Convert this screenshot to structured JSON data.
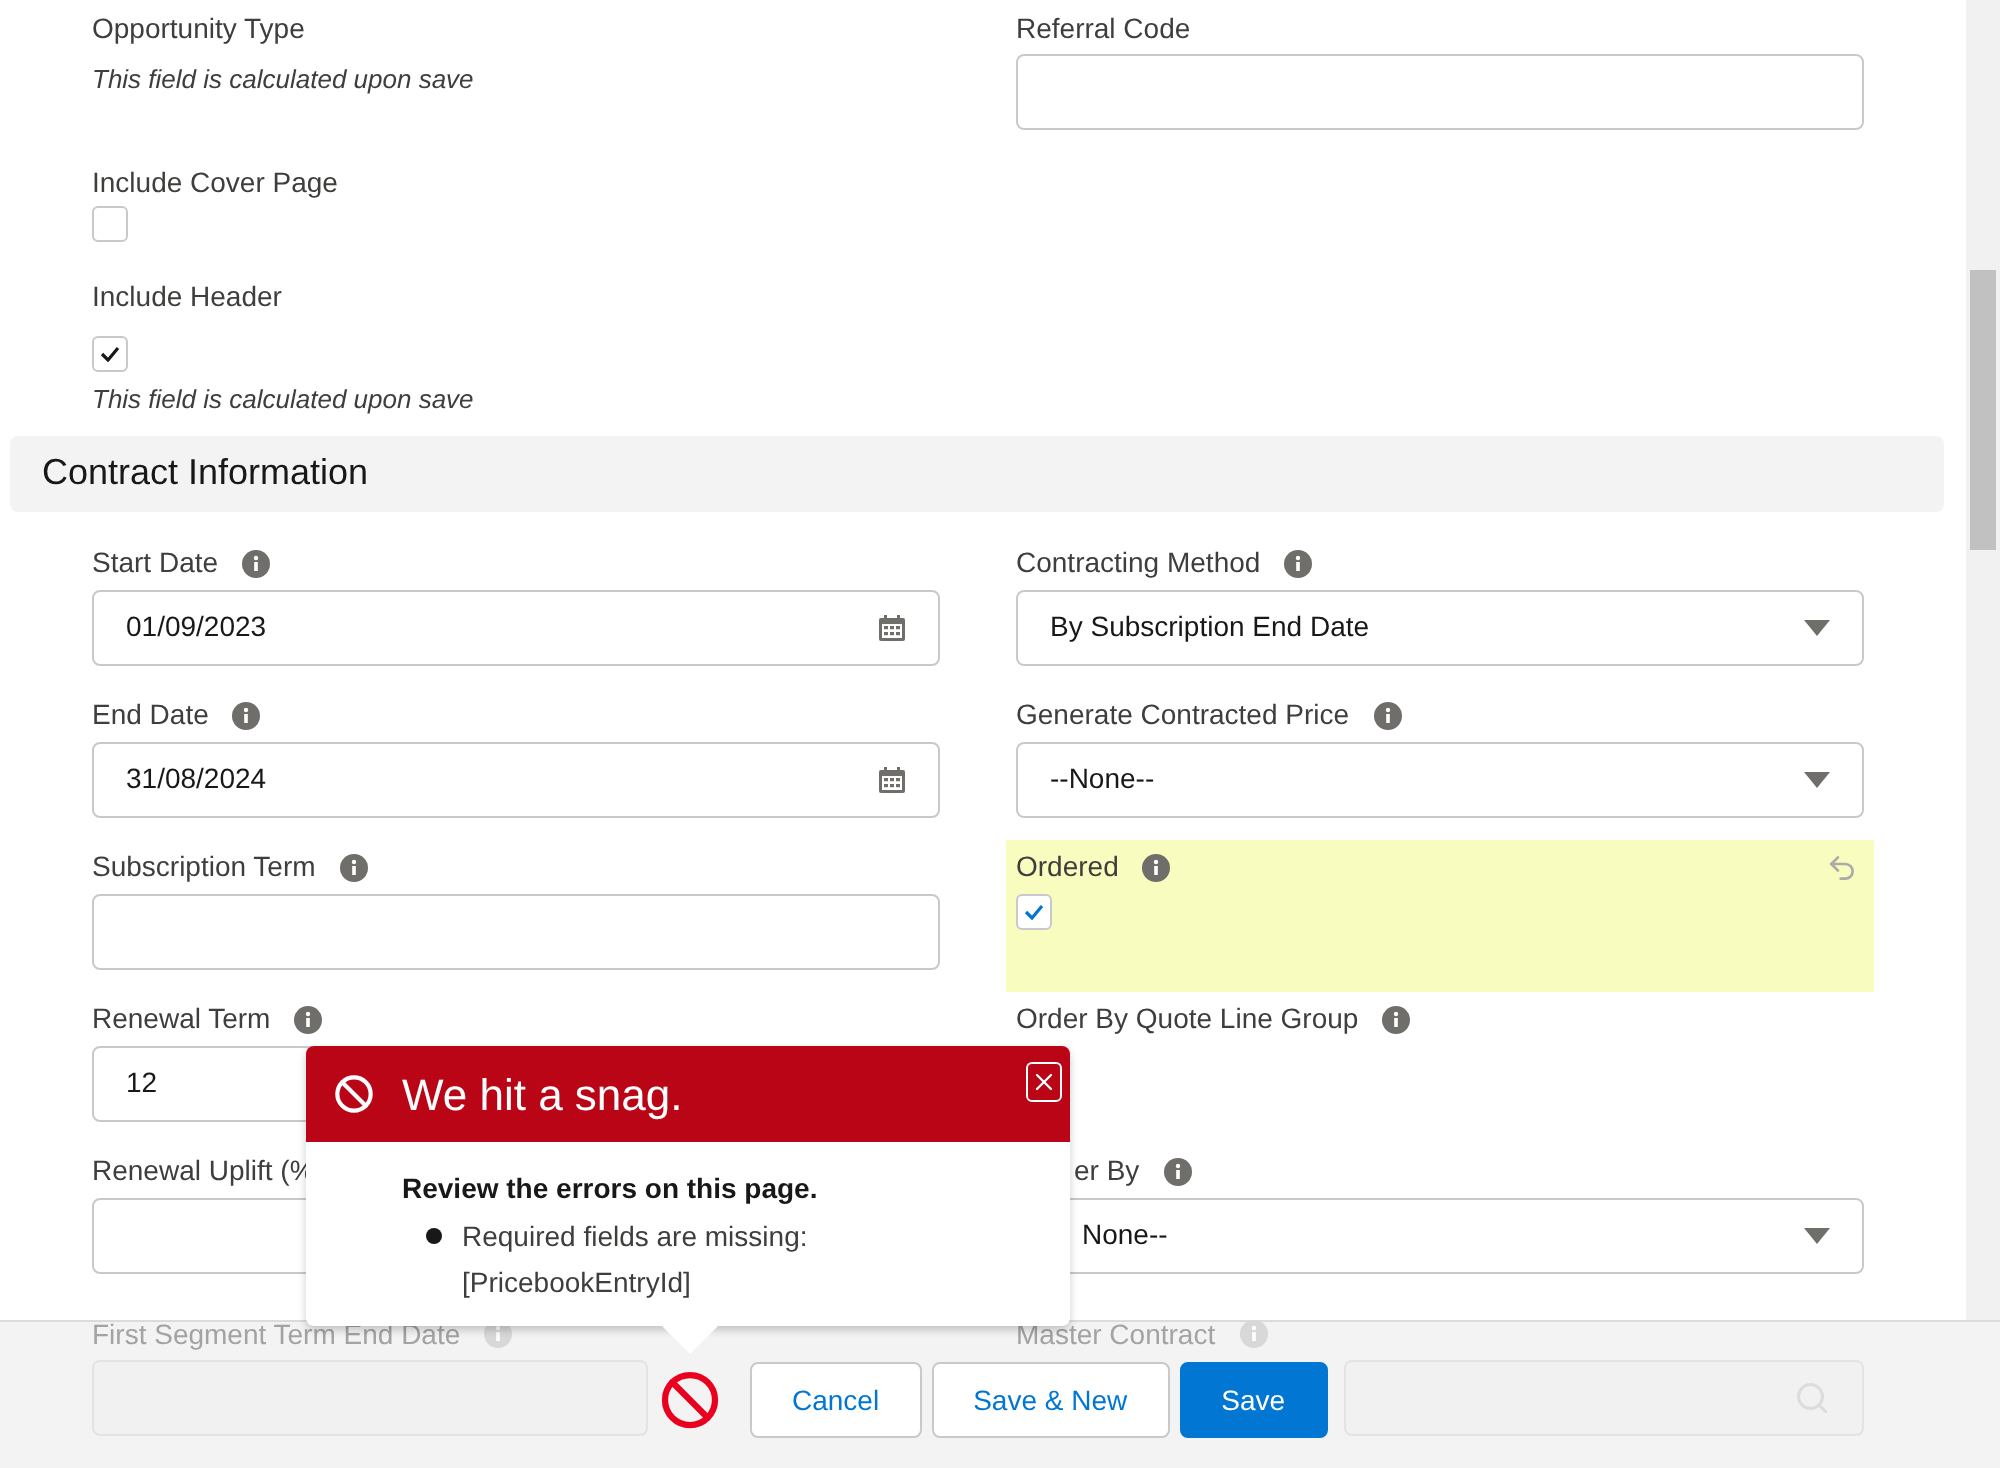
{
  "top_section": {
    "left": [
      {
        "kind": "calculated",
        "label": "Opportunity Type",
        "note": "This field is calculated upon save"
      },
      {
        "kind": "checkbox",
        "label": "Include Cover Page",
        "checked": false
      },
      {
        "kind": "checkbox",
        "label": "Include Header",
        "checked": true,
        "note": "This field is calculated upon save"
      }
    ],
    "right": [
      {
        "kind": "text",
        "label": "Referral Code"
      }
    ]
  },
  "section": {
    "title": "Contract Information",
    "rows": [
      [
        {
          "kind": "date",
          "label": "Start Date",
          "info": true,
          "value": "01/09/2023"
        },
        {
          "kind": "select",
          "label": "Contracting Method",
          "info": true,
          "value": "By Subscription End Date"
        }
      ],
      [
        {
          "kind": "date",
          "label": "End Date",
          "info": true,
          "value": "31/08/2024"
        },
        {
          "kind": "select",
          "label": "Generate Contracted Price",
          "info": true,
          "value": "--None--"
        }
      ],
      [
        {
          "kind": "text",
          "label": "Subscription Term",
          "info": true
        },
        {
          "kind": "checkbox",
          "label": "Ordered",
          "info": true,
          "checked": true,
          "changed": true
        }
      ],
      [
        {
          "kind": "text",
          "label": "Renewal Term",
          "info": true,
          "value": "12"
        },
        {
          "kind": "blank",
          "label": "Order By Quote Line Group",
          "info": true
        }
      ],
      [
        {
          "kind": "text",
          "label": "Renewal Uplift (%"
        },
        {
          "kind": "select",
          "label": "er By",
          "info": true,
          "value": "None--",
          "covered": true
        }
      ]
    ],
    "faded_row": [
      {
        "kind": "date",
        "label": "First Segment Term End Date",
        "info": true
      },
      {
        "kind": "lookup",
        "label": "Master Contract",
        "info": true
      }
    ]
  },
  "error_popover": {
    "title": "We hit a snag.",
    "heading": "Review the errors on this page.",
    "errors": [
      "Required fields are missing: [PricebookEntryId]"
    ]
  },
  "footer": {
    "error_shown": true,
    "buttons": [
      {
        "label": "Cancel",
        "kind": "neutral"
      },
      {
        "label": "Save & New",
        "kind": "neutral"
      },
      {
        "label": "Save",
        "kind": "brand"
      }
    ]
  }
}
